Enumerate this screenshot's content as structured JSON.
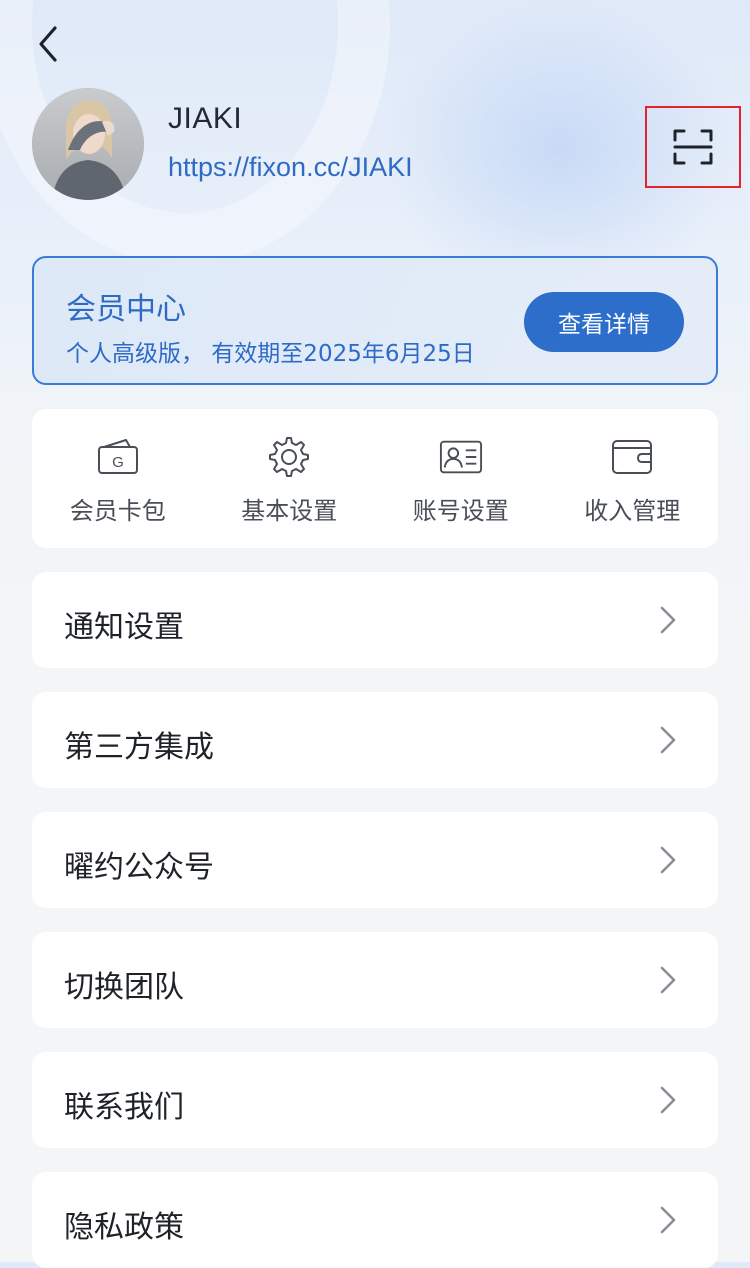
{
  "profile": {
    "name": "JIAKI",
    "link": "https://fixon.cc/JIAKI"
  },
  "membership": {
    "title": "会员中心",
    "subtitle": "个人高级版， 有效期至2025年6月25日",
    "button_label": "查看详情"
  },
  "shortcuts": [
    {
      "label": "会员卡包",
      "icon": "member-card-icon"
    },
    {
      "label": "基本设置",
      "icon": "gear-icon"
    },
    {
      "label": "账号设置",
      "icon": "id-card-icon"
    },
    {
      "label": "收入管理",
      "icon": "wallet-icon"
    }
  ],
  "menu": [
    {
      "label": "通知设置"
    },
    {
      "label": "第三方集成"
    },
    {
      "label": "曜约公众号"
    },
    {
      "label": "切换团队"
    },
    {
      "label": "联系我们"
    },
    {
      "label": "隐私政策"
    }
  ],
  "icons": {
    "back": "chevron-left-icon",
    "scan": "scan-icon",
    "row_arrow": "chevron-right-icon"
  },
  "colors": {
    "accent": "#2e6ecb",
    "link": "#2f6bc5",
    "highlight_box": "#e5232b"
  }
}
